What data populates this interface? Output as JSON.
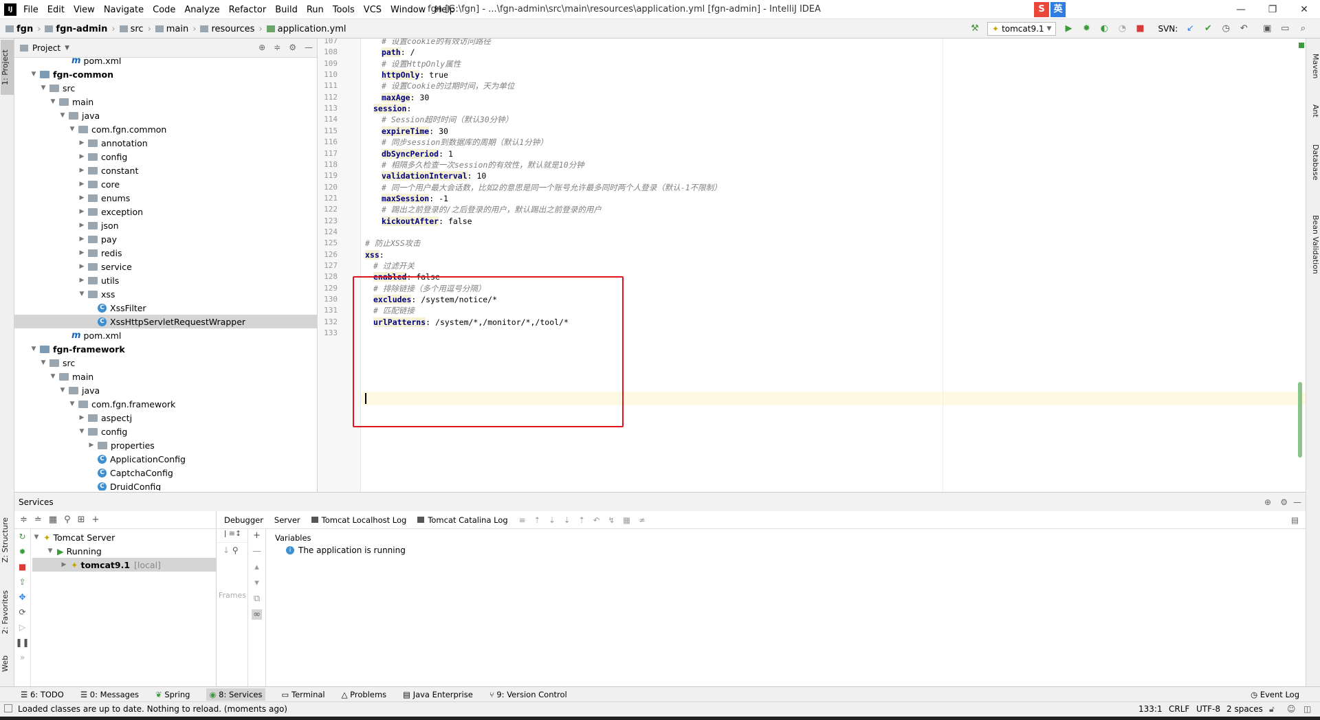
{
  "menubar": {
    "logo": "IJ",
    "items": [
      "File",
      "Edit",
      "View",
      "Navigate",
      "Code",
      "Analyze",
      "Refactor",
      "Build",
      "Run",
      "Tools",
      "VCS",
      "Window",
      "Help"
    ],
    "title": "fgn [G:\\fgn] - ...\\fgn-admin\\src\\main\\resources\\application.yml [fgn-admin] - IntelliJ IDEA",
    "ime": [
      "S",
      "英"
    ],
    "ime_colors": [
      "#e8473a",
      "#2f7de1"
    ]
  },
  "navbar": {
    "crumbs": [
      "fgn",
      "fgn-admin",
      "src",
      "main",
      "resources",
      "application.yml"
    ],
    "run_config": "tomcat9.1",
    "svn_label": "SVN:"
  },
  "left_stripe": {
    "project": "1: Project",
    "structure": "Z: Structure",
    "favorites": "2: Favorites",
    "web": "Web"
  },
  "right_stripe": [
    "Maven",
    "Ant",
    "Database",
    "Bean Validation"
  ],
  "project": {
    "title": "Project",
    "tree": [
      {
        "label": "pom.xml",
        "kind": "maven"
      },
      {
        "label": "fgn-common",
        "kind": "module"
      },
      {
        "label": "src",
        "kind": "folder"
      },
      {
        "label": "main",
        "kind": "folder"
      },
      {
        "label": "java",
        "kind": "folder"
      },
      {
        "label": "com.fgn.common",
        "kind": "package"
      },
      {
        "label": "annotation",
        "kind": "package"
      },
      {
        "label": "config",
        "kind": "package"
      },
      {
        "label": "constant",
        "kind": "package"
      },
      {
        "label": "core",
        "kind": "package"
      },
      {
        "label": "enums",
        "kind": "package"
      },
      {
        "label": "exception",
        "kind": "package"
      },
      {
        "label": "json",
        "kind": "package"
      },
      {
        "label": "pay",
        "kind": "package"
      },
      {
        "label": "redis",
        "kind": "package"
      },
      {
        "label": "service",
        "kind": "package"
      },
      {
        "label": "utils",
        "kind": "package"
      },
      {
        "label": "xss",
        "kind": "package"
      },
      {
        "label": "XssFilter",
        "kind": "class"
      },
      {
        "label": "XssHttpServletRequestWrapper",
        "kind": "class"
      },
      {
        "label": "pom.xml",
        "kind": "maven"
      },
      {
        "label": "fgn-framework",
        "kind": "module"
      },
      {
        "label": "src",
        "kind": "folder"
      },
      {
        "label": "main",
        "kind": "folder"
      },
      {
        "label": "java",
        "kind": "folder"
      },
      {
        "label": "com.fgn.framework",
        "kind": "package"
      },
      {
        "label": "aspectj",
        "kind": "package"
      },
      {
        "label": "config",
        "kind": "package"
      },
      {
        "label": "properties",
        "kind": "package"
      },
      {
        "label": "ApplicationConfig",
        "kind": "class"
      },
      {
        "label": "CaptchaConfig",
        "kind": "class"
      },
      {
        "label": "DruidConfig",
        "kind": "class"
      }
    ]
  },
  "editor": {
    "lines": [
      {
        "n": "107",
        "comment": "# 设置cookie的有效访问路径"
      },
      {
        "n": "108",
        "key": "path",
        "val": " /"
      },
      {
        "n": "109",
        "comment": "# 设置HttpOnly属性"
      },
      {
        "n": "110",
        "key": "httpOnly",
        "val": " true"
      },
      {
        "n": "111",
        "comment": "# 设置Cookie的过期时间，天为单位"
      },
      {
        "n": "112",
        "key": "maxAge",
        "val": " 30"
      },
      {
        "n": "113",
        "key": "session",
        "val": ""
      },
      {
        "n": "114",
        "comment": "# Session超时时间（默认30分钟）"
      },
      {
        "n": "115",
        "key": "expireTime",
        "val": " 30"
      },
      {
        "n": "116",
        "comment": "# 同步session到数据库的周期（默认1分钟）"
      },
      {
        "n": "117",
        "key": "dbSyncPeriod",
        "val": " 1"
      },
      {
        "n": "118",
        "comment": "# 相隔多久检查一次session的有效性，默认就是10分钟"
      },
      {
        "n": "119",
        "key": "validationInterval",
        "val": " 10"
      },
      {
        "n": "120",
        "comment": "# 同一个用户最大会话数，比如2的意思是同一个账号允许最多同时两个人登录（默认-1不限制）"
      },
      {
        "n": "121",
        "key": "maxSession",
        "val": " -1"
      },
      {
        "n": "122",
        "comment": "# 踢出之前登录的/之后登录的用户，默认踢出之前登录的用户"
      },
      {
        "n": "123",
        "key": "kickoutAfter",
        "val": " false"
      },
      {
        "n": "124"
      },
      {
        "n": "125",
        "comment": "# 防止XSS攻击"
      },
      {
        "n": "126",
        "key": "xss",
        "val": ""
      },
      {
        "n": "127",
        "comment": "# 过滤开关"
      },
      {
        "n": "128",
        "key": "enabled",
        "val": " false"
      },
      {
        "n": "129",
        "comment": "# 排除链接（多个用逗号分隔）"
      },
      {
        "n": "130",
        "key": "excludes",
        "val": " /system/notice/*"
      },
      {
        "n": "131",
        "comment": "# 匹配链接"
      },
      {
        "n": "132",
        "key": "urlPatterns",
        "val": " /system/*,/monitor/*,/tool/*"
      },
      {
        "n": "133"
      }
    ]
  },
  "services": {
    "title": "Services",
    "tree": [
      "Tomcat Server",
      "Running",
      "tomcat9.1",
      "[local]"
    ],
    "tabs": [
      "Debugger",
      "Server",
      "Tomcat Localhost Log",
      "Tomcat Catalina Log"
    ],
    "variables": "Variables",
    "frames": "Frames ar",
    "running_msg": "The application is running"
  },
  "bottom_tabs": [
    "6: TODO",
    "0: Messages",
    "Spring",
    "8: Services",
    "Terminal",
    "Problems",
    "Java Enterprise",
    "9: Version Control"
  ],
  "event_log": "Event Log",
  "status": {
    "message": "Loaded classes are up to date. Nothing to reload. (moments ago)",
    "position": "133:1",
    "line_sep": "CRLF",
    "encoding": "UTF-8",
    "indent": "2 spaces"
  }
}
